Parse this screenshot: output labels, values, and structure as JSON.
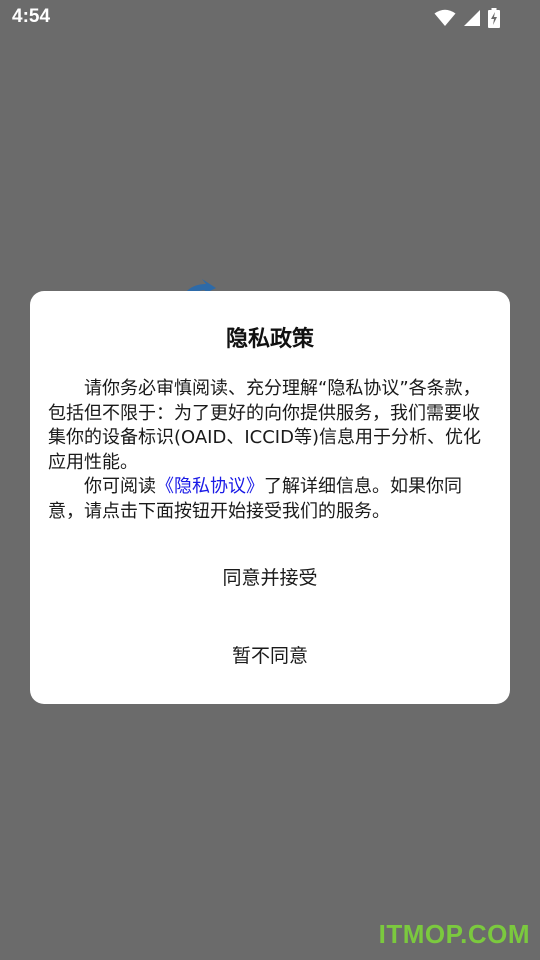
{
  "status_bar": {
    "time": "4:54",
    "icons": [
      "wifi-icon",
      "cellular-signal-icon",
      "battery-charging-icon"
    ]
  },
  "dialog": {
    "title": "隐私政策",
    "paragraph1": "请你务必审慎阅读、充分理解“隐私协议”各条款，包括但不限于：为了更好的向你提供服务，我们需要收集你的设备标识(OAID、ICCID等)信息用于分析、优化应用性能。",
    "paragraph2_prefix": "你可阅读",
    "policy_link": "《隐私协议》",
    "paragraph2_suffix": "了解详细信息。如果你同意，请点击下面按钮开始接受我们的服务。",
    "agree_button": "同意并接受",
    "decline_button": "暂不同意"
  },
  "watermark": "ITMOP.COM",
  "colors": {
    "overlay": "#6b6b6b",
    "link": "#1a1ae6",
    "watermark": "#7dd43a"
  }
}
